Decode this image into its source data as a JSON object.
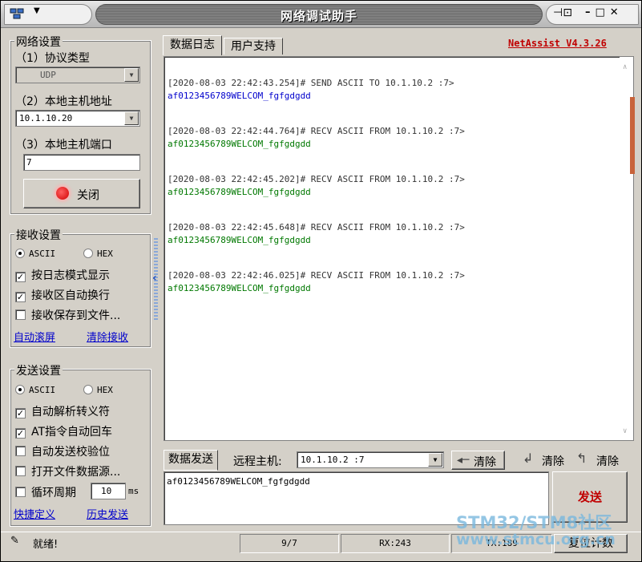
{
  "window": {
    "title": "网络调试助手"
  },
  "network": {
    "legend": "网络设置",
    "protocol_label": "（1）协议类型",
    "protocol_value": "UDP",
    "host_label": "（2）本地主机地址",
    "host_value": "10.1.10.20",
    "port_label": "（3）本地主机端口",
    "port_value": "7",
    "close_button": "关闭"
  },
  "receive": {
    "legend": "接收设置",
    "ascii": "ASCII",
    "hex": "HEX",
    "log_mode": "按日志模式显示",
    "auto_wrap": "接收区自动换行",
    "save_file": "接收保存到文件...",
    "auto_scroll": "自动滚屏",
    "clear_recv": "清除接收"
  },
  "send": {
    "legend": "发送设置",
    "ascii": "ASCII",
    "hex": "HEX",
    "parse_escape": "自动解析转义符",
    "at_return": "AT指令自动回车",
    "auto_checksum": "自动发送校验位",
    "open_file": "打开文件数据源...",
    "loop": "循环周期",
    "loop_value": "10",
    "loop_unit": "ms",
    "shortcut": "快捷定义",
    "history": "历史发送"
  },
  "tabs": {
    "log": "数据日志",
    "support": "用户支持"
  },
  "version": "NetAssist V4.3.26",
  "log": [
    {
      "head": "[2020-08-03 22:42:43.254]# SEND ASCII TO 10.1.10.2 :7>",
      "body": "af0123456789WELCOM_fgfgdgdd",
      "kind": "send"
    },
    {
      "head": "[2020-08-03 22:42:44.764]# RECV ASCII FROM 10.1.10.2 :7>",
      "body": "af0123456789WELCOM_fgfgdgdd",
      "kind": "recv"
    },
    {
      "head": "[2020-08-03 22:42:45.202]# RECV ASCII FROM 10.1.10.2 :7>",
      "body": "af0123456789WELCOM_fgfgdgdd",
      "kind": "recv"
    },
    {
      "head": "[2020-08-03 22:42:45.648]# RECV ASCII FROM 10.1.10.2 :7>",
      "body": "af0123456789WELCOM_fgfgdgdd",
      "kind": "recv"
    },
    {
      "head": "[2020-08-03 22:42:46.025]# RECV ASCII FROM 10.1.10.2 :7>",
      "body": "af0123456789WELCOM_fgfgdgdd",
      "kind": "recv"
    }
  ],
  "sendbar": {
    "tab": "数据发送",
    "remote_label": "远程主机:",
    "remote_value": "10.1.10.2 :7",
    "clear1": "清除",
    "clear2": "清除",
    "clear3": "清除",
    "send_text": "af0123456789WELCOM_fgfgdgdd",
    "send_button": "发送"
  },
  "status": {
    "ready": "就绪!",
    "count": "9/7",
    "rx": "RX:243",
    "tx": "TX:189",
    "reset": "复位计数"
  },
  "watermark": {
    "line1": "STM32/STM8社区",
    "line2": "www.stmcu.org.cn"
  },
  "colors": {
    "send": "#0000cc",
    "recv": "#007800",
    "version": "#c00000"
  }
}
